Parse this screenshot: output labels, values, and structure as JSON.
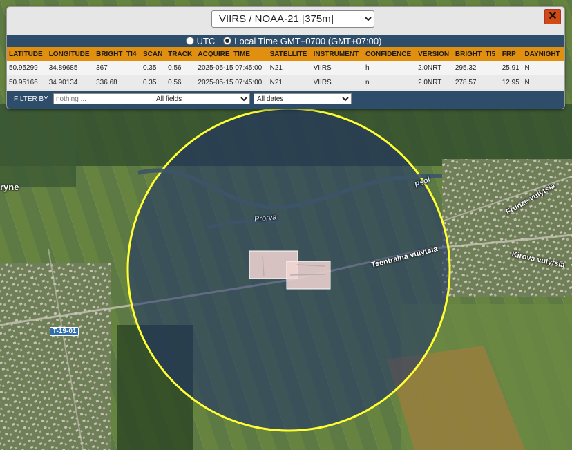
{
  "panel": {
    "satellite_selected": "VIIRS / NOAA-21 [375m]",
    "close_glyph": "✕",
    "time": {
      "utc_label": "UTC",
      "local_label": "Local Time GMT+0700 (GMT+07:00)",
      "selected": "local"
    },
    "columns": [
      "LATITUDE",
      "LONGITUDE",
      "BRIGHT_TI4",
      "SCAN",
      "TRACK",
      "ACQUIRE_TIME",
      "SATELLITE",
      "INSTRUMENT",
      "CONFIDENCE",
      "VERSION",
      "BRIGHT_TI5",
      "FRP",
      "DAYNIGHT"
    ],
    "rows": [
      [
        "50.95299",
        "34.89685",
        "367",
        "0.35",
        "0.56",
        "2025-05-15 07:45:00",
        "N21",
        "VIIRS",
        "h",
        "2.0NRT",
        "295.32",
        "25.91",
        "N"
      ],
      [
        "50.95166",
        "34.90134",
        "336.68",
        "0.35",
        "0.56",
        "2025-05-15 07:45:00",
        "N21",
        "VIIRS",
        "n",
        "2.0NRT",
        "278.57",
        "12.95",
        "N"
      ]
    ],
    "filter": {
      "label": "FILTER BY",
      "placeholder": "nothing ...",
      "field_selected": "All fields",
      "date_selected": "All dates"
    }
  },
  "map": {
    "labels": {
      "town_partial": "ryne",
      "river_psol": "Psol",
      "river_prorva": "Prorva",
      "street_tsentralna": "Tsentralna vulytsia",
      "street_frunze": "Frunze vulytsia",
      "street_kirova": "Kirova vulytsia",
      "road_shield": "T-19-01"
    },
    "colors": {
      "circle_stroke": "#ffff33",
      "circle_fill": "#1e2f6b",
      "panel_header": "#2e4d6b",
      "table_header": "#e08f0e",
      "close_button": "#d04a12"
    }
  }
}
